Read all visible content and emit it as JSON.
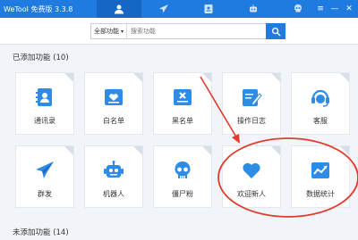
{
  "app": {
    "title": "WeTool 免费版 3.3.8"
  },
  "nav": [
    {
      "id": "nav-contacts",
      "icon": "person-icon",
      "active": true
    },
    {
      "id": "nav-broadcast",
      "icon": "paper-plane-icon",
      "active": false
    },
    {
      "id": "nav-profile",
      "icon": "id-card-icon",
      "active": false
    },
    {
      "id": "nav-robot",
      "icon": "robot-icon",
      "active": false
    },
    {
      "id": "nav-skull",
      "icon": "skull-icon",
      "active": false
    }
  ],
  "window_controls": {
    "menu": "≡",
    "minimize": "—",
    "close": "✕"
  },
  "search": {
    "scope": "全部功能",
    "placeholder": "搜索功能"
  },
  "added_section": {
    "label": "已添加功能 (10)"
  },
  "features": [
    {
      "label": "通讯录",
      "icon": "address-book-icon"
    },
    {
      "label": "白名单",
      "icon": "whitelist-icon"
    },
    {
      "label": "黑名单",
      "icon": "blacklist-icon"
    },
    {
      "label": "操作日志",
      "icon": "edit-log-icon"
    },
    {
      "label": "客服",
      "icon": "headset-icon"
    },
    {
      "label": "群发",
      "icon": "paper-plane-icon"
    },
    {
      "label": "机器人",
      "icon": "robot-icon"
    },
    {
      "label": "僵尸粉",
      "icon": "skull-icon"
    },
    {
      "label": "欢迎新人",
      "icon": "heart-icon"
    },
    {
      "label": "数据统计",
      "icon": "chart-icon"
    }
  ],
  "not_added_section": {
    "label": "未添加功能 (14)"
  },
  "colors": {
    "brand": "#1f7be0",
    "icon_blue": "#2e8be6",
    "annotation_red": "#e23b2e"
  }
}
